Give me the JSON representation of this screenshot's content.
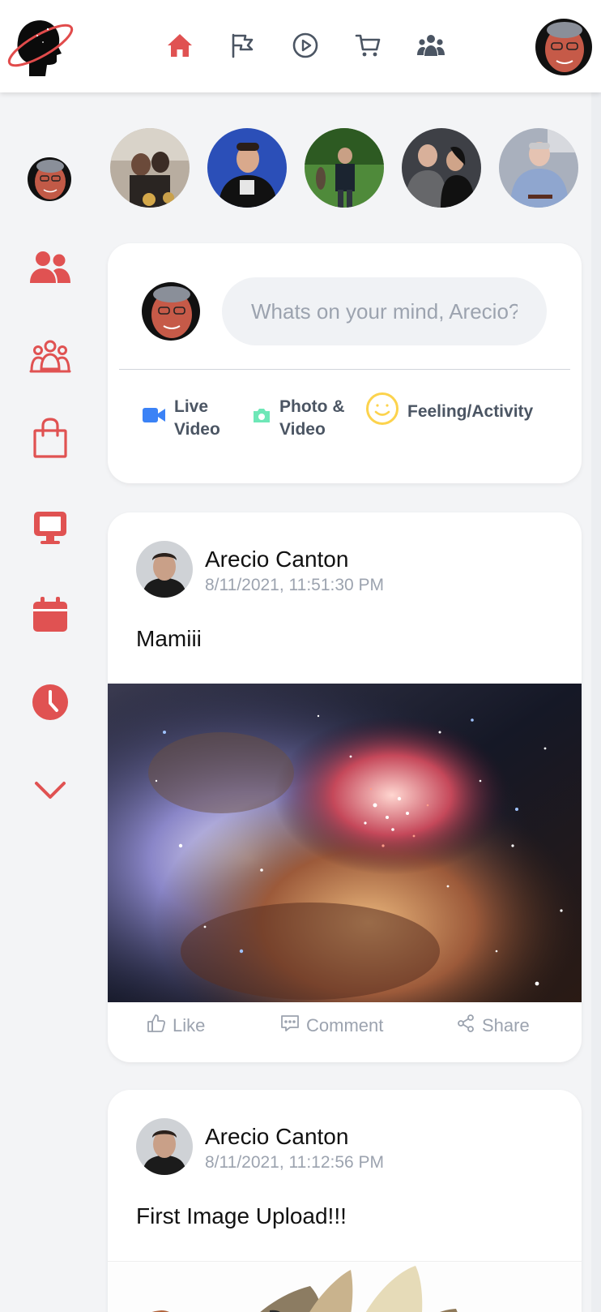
{
  "header": {
    "logo_icon": "saturn-head-logo",
    "nav_icons": [
      "home-icon",
      "flag-icon",
      "play-icon",
      "cart-icon",
      "users-icon"
    ],
    "active_nav": "home",
    "accent_color": "#e05252",
    "inactive_color": "#4b5563"
  },
  "sidebar": {
    "items": [
      "friends-icon",
      "groups-icon",
      "marketplace-icon",
      "watch-icon",
      "events-icon",
      "memories-icon",
      "see-more-chevron-icon"
    ]
  },
  "stories": {
    "count": 5
  },
  "composer": {
    "placeholder": "Whats on your mind, Arecio?",
    "actions": [
      {
        "label_line1": "Live",
        "label_line2": "Video",
        "icon": "video-camera-icon",
        "color": "#3b82f6"
      },
      {
        "label_line1": "Photo &",
        "label_line2": "Video",
        "icon": "camera-icon",
        "color": "#6ee7b7"
      },
      {
        "label": "Feeling/Activity",
        "icon": "smiley-icon",
        "color": "#fcd34d"
      }
    ]
  },
  "posts": [
    {
      "author": "Arecio Canton",
      "timestamp": "8/11/2021, 11:51:30 PM",
      "text": "Mamiii",
      "image": "nebula"
    },
    {
      "author": "Arecio Canton",
      "timestamp": "8/11/2021, 11:12:56 PM",
      "text": "First Image Upload!!!",
      "image": "cartoon"
    }
  ],
  "post_actions": {
    "like": "Like",
    "comment": "Comment",
    "share": "Share"
  }
}
